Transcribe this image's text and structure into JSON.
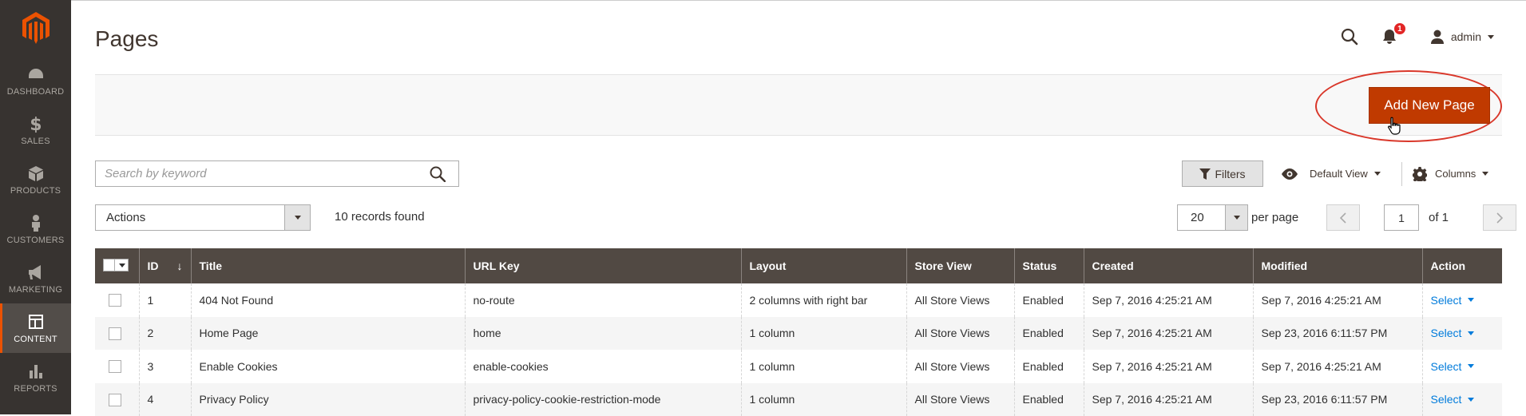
{
  "sidebar": {
    "logo": "magento-logo",
    "items": [
      {
        "label": "DASHBOARD",
        "icon": "dashboard-icon",
        "active": false
      },
      {
        "label": "SALES",
        "icon": "dollar-icon",
        "active": false
      },
      {
        "label": "PRODUCTS",
        "icon": "cube-icon",
        "active": false
      },
      {
        "label": "CUSTOMERS",
        "icon": "person-icon",
        "active": false
      },
      {
        "label": "MARKETING",
        "icon": "megaphone-icon",
        "active": false
      },
      {
        "label": "CONTENT",
        "icon": "layout-icon",
        "active": true
      },
      {
        "label": "REPORTS",
        "icon": "bar-chart-icon",
        "active": false
      }
    ]
  },
  "header": {
    "title": "Pages",
    "notifications_count": "1",
    "user": "admin"
  },
  "action_bar": {
    "add_label": "Add New Page"
  },
  "toolbar": {
    "search_placeholder": "Search by keyword",
    "filters_label": "Filters",
    "view_label": "Default View",
    "columns_label": "Columns",
    "actions_label": "Actions",
    "records": "10 records found",
    "per_page_value": "20",
    "per_page_label": "per page",
    "page_value": "1",
    "page_of": "of 1"
  },
  "grid": {
    "columns": [
      "ID",
      "Title",
      "URL Key",
      "Layout",
      "Store View",
      "Status",
      "Created",
      "Modified",
      "Action"
    ],
    "sort_arrow": "↓",
    "rows": [
      {
        "id": "1",
        "title": "404 Not Found",
        "url": "no-route",
        "layout": "2 columns with right bar",
        "store": "All Store Views",
        "status": "Enabled",
        "created": "Sep 7, 2016 4:25:21 AM",
        "modified": "Sep 7, 2016 4:25:21 AM",
        "action": "Select"
      },
      {
        "id": "2",
        "title": "Home Page",
        "url": "home",
        "layout": "1 column",
        "store": "All Store Views",
        "status": "Enabled",
        "created": "Sep 7, 2016 4:25:21 AM",
        "modified": "Sep 23, 2016 6:11:57 PM",
        "action": "Select"
      },
      {
        "id": "3",
        "title": "Enable Cookies",
        "url": "enable-cookies",
        "layout": "1 column",
        "store": "All Store Views",
        "status": "Enabled",
        "created": "Sep 7, 2016 4:25:21 AM",
        "modified": "Sep 7, 2016 4:25:21 AM",
        "action": "Select"
      },
      {
        "id": "4",
        "title": "Privacy Policy",
        "url": "privacy-policy-cookie-restriction-mode",
        "layout": "1 column",
        "store": "All Store Views",
        "status": "Enabled",
        "created": "Sep 7, 2016 4:25:21 AM",
        "modified": "Sep 23, 2016 6:11:57 PM",
        "action": "Select"
      }
    ]
  },
  "colors": {
    "sidebar_bg": "#373330",
    "accent": "#eb5202",
    "primary_button": "#c03a00",
    "grid_header": "#514943",
    "link": "#007bdb",
    "highlight": "#d9372a"
  }
}
